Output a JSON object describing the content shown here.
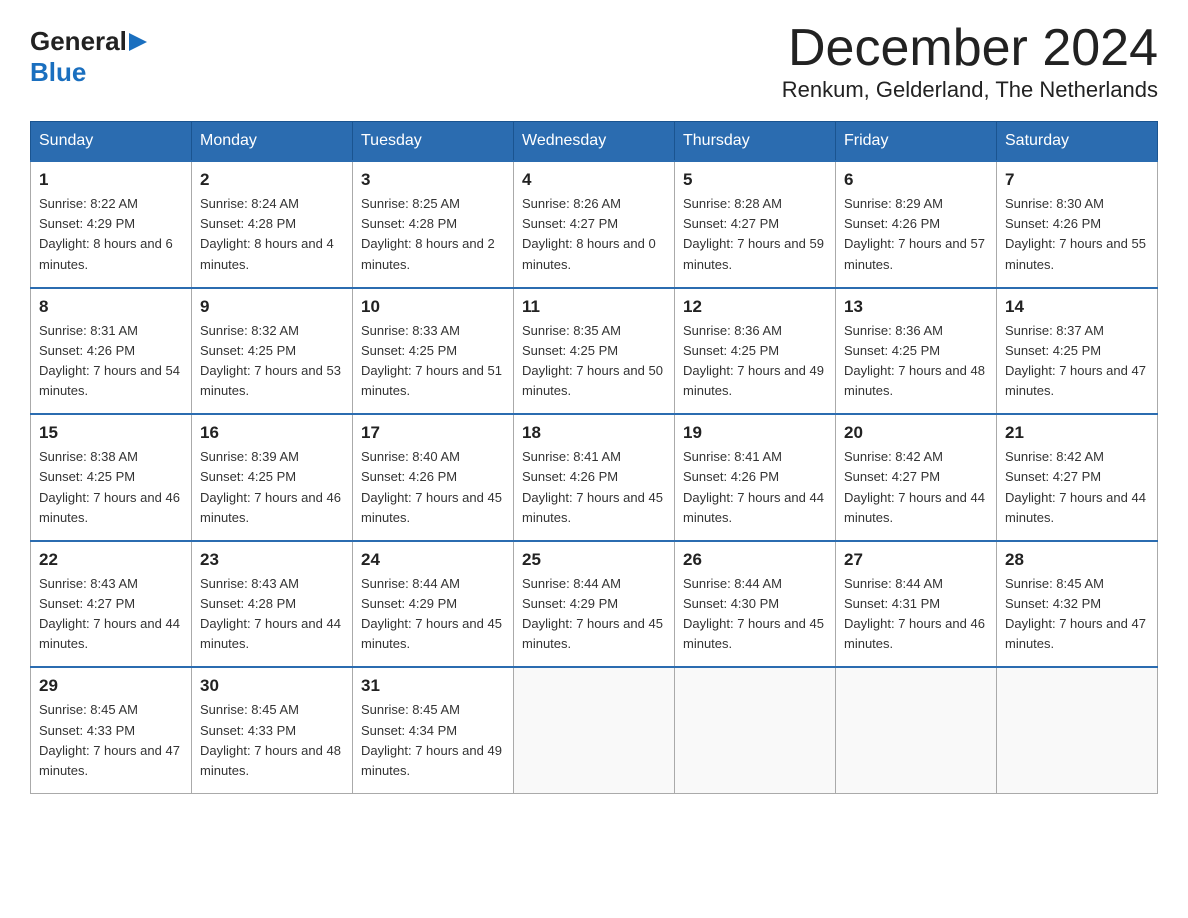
{
  "logo": {
    "general": "General",
    "blue": "Blue"
  },
  "title": "December 2024",
  "subtitle": "Renkum, Gelderland, The Netherlands",
  "days_of_week": [
    "Sunday",
    "Monday",
    "Tuesday",
    "Wednesday",
    "Thursday",
    "Friday",
    "Saturday"
  ],
  "weeks": [
    [
      {
        "day": "1",
        "sunrise": "8:22 AM",
        "sunset": "4:29 PM",
        "daylight": "8 hours and 6 minutes."
      },
      {
        "day": "2",
        "sunrise": "8:24 AM",
        "sunset": "4:28 PM",
        "daylight": "8 hours and 4 minutes."
      },
      {
        "day": "3",
        "sunrise": "8:25 AM",
        "sunset": "4:28 PM",
        "daylight": "8 hours and 2 minutes."
      },
      {
        "day": "4",
        "sunrise": "8:26 AM",
        "sunset": "4:27 PM",
        "daylight": "8 hours and 0 minutes."
      },
      {
        "day": "5",
        "sunrise": "8:28 AM",
        "sunset": "4:27 PM",
        "daylight": "7 hours and 59 minutes."
      },
      {
        "day": "6",
        "sunrise": "8:29 AM",
        "sunset": "4:26 PM",
        "daylight": "7 hours and 57 minutes."
      },
      {
        "day": "7",
        "sunrise": "8:30 AM",
        "sunset": "4:26 PM",
        "daylight": "7 hours and 55 minutes."
      }
    ],
    [
      {
        "day": "8",
        "sunrise": "8:31 AM",
        "sunset": "4:26 PM",
        "daylight": "7 hours and 54 minutes."
      },
      {
        "day": "9",
        "sunrise": "8:32 AM",
        "sunset": "4:25 PM",
        "daylight": "7 hours and 53 minutes."
      },
      {
        "day": "10",
        "sunrise": "8:33 AM",
        "sunset": "4:25 PM",
        "daylight": "7 hours and 51 minutes."
      },
      {
        "day": "11",
        "sunrise": "8:35 AM",
        "sunset": "4:25 PM",
        "daylight": "7 hours and 50 minutes."
      },
      {
        "day": "12",
        "sunrise": "8:36 AM",
        "sunset": "4:25 PM",
        "daylight": "7 hours and 49 minutes."
      },
      {
        "day": "13",
        "sunrise": "8:36 AM",
        "sunset": "4:25 PM",
        "daylight": "7 hours and 48 minutes."
      },
      {
        "day": "14",
        "sunrise": "8:37 AM",
        "sunset": "4:25 PM",
        "daylight": "7 hours and 47 minutes."
      }
    ],
    [
      {
        "day": "15",
        "sunrise": "8:38 AM",
        "sunset": "4:25 PM",
        "daylight": "7 hours and 46 minutes."
      },
      {
        "day": "16",
        "sunrise": "8:39 AM",
        "sunset": "4:25 PM",
        "daylight": "7 hours and 46 minutes."
      },
      {
        "day": "17",
        "sunrise": "8:40 AM",
        "sunset": "4:26 PM",
        "daylight": "7 hours and 45 minutes."
      },
      {
        "day": "18",
        "sunrise": "8:41 AM",
        "sunset": "4:26 PM",
        "daylight": "7 hours and 45 minutes."
      },
      {
        "day": "19",
        "sunrise": "8:41 AM",
        "sunset": "4:26 PM",
        "daylight": "7 hours and 44 minutes."
      },
      {
        "day": "20",
        "sunrise": "8:42 AM",
        "sunset": "4:27 PM",
        "daylight": "7 hours and 44 minutes."
      },
      {
        "day": "21",
        "sunrise": "8:42 AM",
        "sunset": "4:27 PM",
        "daylight": "7 hours and 44 minutes."
      }
    ],
    [
      {
        "day": "22",
        "sunrise": "8:43 AM",
        "sunset": "4:27 PM",
        "daylight": "7 hours and 44 minutes."
      },
      {
        "day": "23",
        "sunrise": "8:43 AM",
        "sunset": "4:28 PM",
        "daylight": "7 hours and 44 minutes."
      },
      {
        "day": "24",
        "sunrise": "8:44 AM",
        "sunset": "4:29 PM",
        "daylight": "7 hours and 45 minutes."
      },
      {
        "day": "25",
        "sunrise": "8:44 AM",
        "sunset": "4:29 PM",
        "daylight": "7 hours and 45 minutes."
      },
      {
        "day": "26",
        "sunrise": "8:44 AM",
        "sunset": "4:30 PM",
        "daylight": "7 hours and 45 minutes."
      },
      {
        "day": "27",
        "sunrise": "8:44 AM",
        "sunset": "4:31 PM",
        "daylight": "7 hours and 46 minutes."
      },
      {
        "day": "28",
        "sunrise": "8:45 AM",
        "sunset": "4:32 PM",
        "daylight": "7 hours and 47 minutes."
      }
    ],
    [
      {
        "day": "29",
        "sunrise": "8:45 AM",
        "sunset": "4:33 PM",
        "daylight": "7 hours and 47 minutes."
      },
      {
        "day": "30",
        "sunrise": "8:45 AM",
        "sunset": "4:33 PM",
        "daylight": "7 hours and 48 minutes."
      },
      {
        "day": "31",
        "sunrise": "8:45 AM",
        "sunset": "4:34 PM",
        "daylight": "7 hours and 49 minutes."
      },
      null,
      null,
      null,
      null
    ]
  ]
}
